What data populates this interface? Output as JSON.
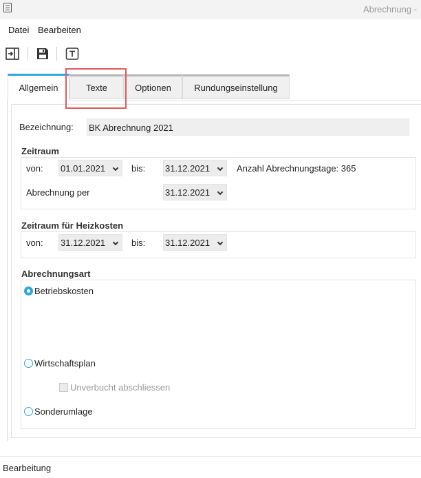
{
  "window": {
    "title": "Abrechnung -"
  },
  "menu": {
    "file": "Datei",
    "edit": "Bearbeiten"
  },
  "toolbar": {
    "icons": [
      "exit-icon",
      "save-icon",
      "text-icon"
    ]
  },
  "tabs": [
    {
      "label": "Allgemein",
      "active": true
    },
    {
      "label": "Texte",
      "active": false
    },
    {
      "label": "Optionen",
      "active": false
    },
    {
      "label": "Rundungseinstellung",
      "active": false
    }
  ],
  "general": {
    "designation_label": "Bezeichnung:",
    "designation_value": "BK Abrechnung 2021"
  },
  "period": {
    "title": "Zeitraum",
    "from_label": "von:",
    "from_value": "01.01.2021",
    "to_label": "bis:",
    "to_value": "31.12.2021",
    "days_label": "Anzahl Abrechnungstage: 365",
    "billing_per_label": "Abrechnung per",
    "billing_per_value": "31.12.2021"
  },
  "heating_period": {
    "title": "Zeitraum für Heizkosten",
    "from_label": "von:",
    "from_value": "31.12.2021",
    "to_label": "bis:",
    "to_value": "31.12.2021"
  },
  "billing_type": {
    "title": "Abrechnungsart",
    "options": [
      {
        "label": "Betriebskosten",
        "checked": true
      },
      {
        "label": "Wirtschaftsplan",
        "checked": false
      },
      {
        "label": "Sonderumlage",
        "checked": false
      }
    ],
    "unbooked_label": "Unverbucht abschliessen"
  },
  "status": {
    "text": "Bearbeitung"
  },
  "colors": {
    "accent": "#2fa6e0",
    "highlight": "#e05a5a"
  }
}
